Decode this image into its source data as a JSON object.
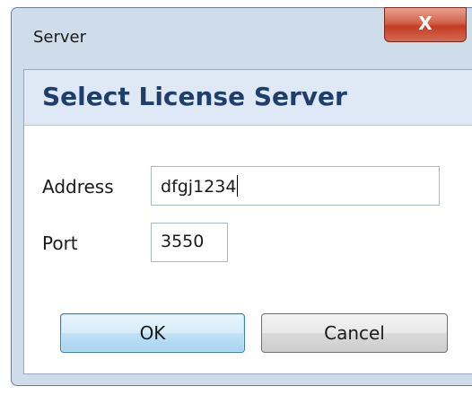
{
  "window": {
    "title": "Server",
    "close_symbol": "X",
    "close_icon": "close-icon"
  },
  "header": {
    "title": "Select License Server"
  },
  "form": {
    "address_label": "Address",
    "address_value": "dfgj1234",
    "port_label": "Port",
    "port_value": "3550"
  },
  "buttons": {
    "ok_label": "OK",
    "cancel_label": "Cancel"
  },
  "colors": {
    "header_text": "#1f3e6b",
    "close_button": "#c43c23",
    "ok_border": "#3c7fb1"
  }
}
